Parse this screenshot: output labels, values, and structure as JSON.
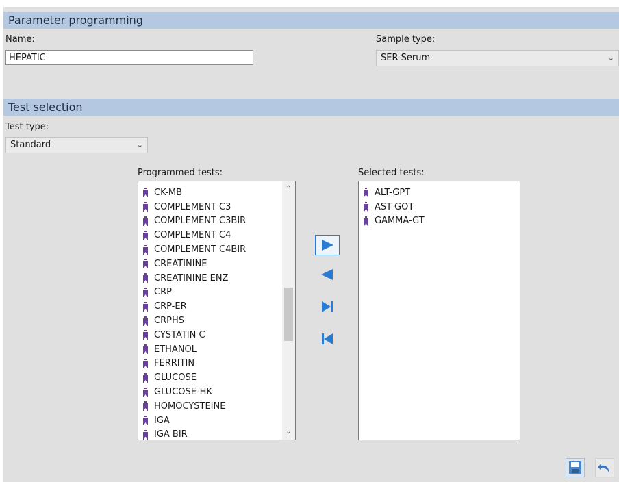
{
  "parameter_section": {
    "title": "Parameter programming",
    "name_label": "Name:",
    "name_value": "HEPATIC",
    "sample_type_label": "Sample type:",
    "sample_type_value": "SER-Serum"
  },
  "test_section": {
    "title": "Test selection",
    "test_type_label": "Test type:",
    "test_type_value": "Standard",
    "programmed_label": "Programmed tests:",
    "selected_label": "Selected tests:",
    "programmed_tests": [
      "CK-MB",
      "COMPLEMENT C3",
      "COMPLEMENT C3BIR",
      "COMPLEMENT C4",
      "COMPLEMENT C4BIR",
      "CREATININE",
      "CREATININE ENZ",
      "CRP",
      "CRP-ER",
      "CRPHS",
      "CYSTATIN C",
      "ETHANOL",
      "FERRITIN",
      "GLUCOSE",
      "GLUCOSE-HK",
      "HOMOCYSTEINE",
      "IGA",
      "IGA BIR"
    ],
    "selected_tests": [
      "ALT-GPT",
      "AST-GOT",
      "GAMMA-GT"
    ]
  },
  "buttons": {
    "add_icon": "triangle-right-icon",
    "remove_icon": "triangle-left-icon",
    "add_all_icon": "skip-last-icon",
    "remove_all_icon": "skip-first-icon",
    "save_icon": "floppy-disk-icon",
    "undo_icon": "undo-arrow-icon"
  },
  "colors": {
    "section_header": "#b4c9e1",
    "panel": "#e0e0e0",
    "accent_blue": "#2a7bd4",
    "tube_purple": "#6b3fa0"
  }
}
